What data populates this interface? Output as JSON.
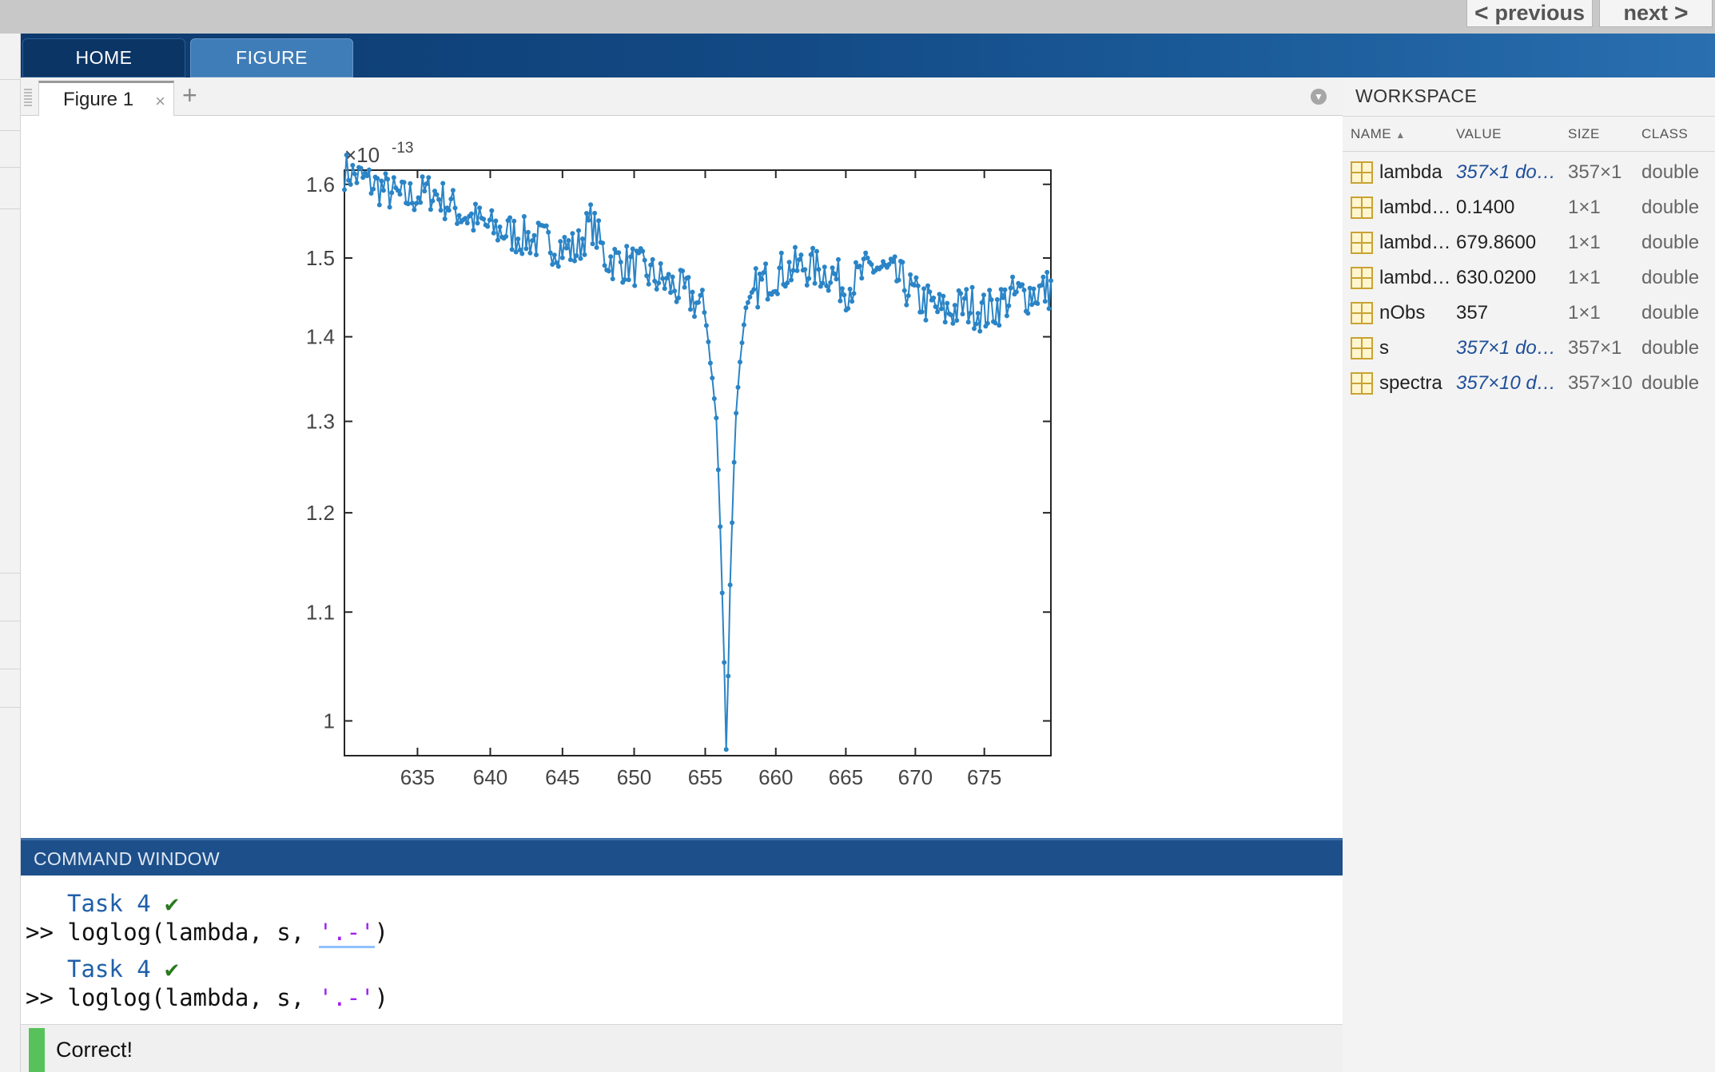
{
  "nav": {
    "previous_label": "previous",
    "next_label": "next"
  },
  "ribbon": {
    "tabs": [
      {
        "label": "HOME"
      },
      {
        "label": "FIGURE"
      }
    ]
  },
  "figure": {
    "tab_label": "Figure 1",
    "close_symbol": "×",
    "add_symbol": "+"
  },
  "chart_data": {
    "type": "line",
    "series": [
      {
        "marker": "point",
        "line": "solid",
        "color": "#2a84c6"
      }
    ],
    "x_ticks": [
      "635",
      "640",
      "645",
      "650",
      "655",
      "660",
      "665",
      "670",
      "675"
    ],
    "y_ticks": [
      "1",
      "1.1",
      "1.2",
      "1.3",
      "1.4",
      "1.5",
      "1.6"
    ],
    "y_exponent_label": "×10",
    "y_exponent_power": "-13",
    "xlim": [
      630.02,
      679.86
    ],
    "ylim": [
      9.7e-14,
      1.62e-13
    ],
    "x_scale": "log",
    "y_scale": "log",
    "grid": false,
    "description_points": {
      "x": [
        630.02,
        632,
        634,
        636,
        638,
        640,
        642,
        644,
        646,
        647,
        648,
        650,
        652,
        654,
        655,
        655.8,
        656.2,
        656.5,
        656.8,
        657.2,
        657.8,
        658.5,
        660,
        662,
        664,
        665,
        667,
        669,
        670,
        672,
        674,
        675,
        677,
        679.86
      ],
      "y": [
        1.62e-13,
        1.6e-13,
        1.58e-13,
        1.59e-13,
        1.56e-13,
        1.54e-13,
        1.53e-13,
        1.52e-13,
        1.51e-13,
        1.55e-13,
        1.5e-13,
        1.49e-13,
        1.47e-13,
        1.45e-13,
        1.43e-13,
        1.3e-13,
        1.12e-13,
        9.7e-14,
        1.15e-13,
        1.32e-13,
        1.43e-13,
        1.46e-13,
        1.48e-13,
        1.49e-13,
        1.48e-13,
        1.46e-13,
        1.49e-13,
        1.47e-13,
        1.45e-13,
        1.43e-13,
        1.44e-13,
        1.43e-13,
        1.45e-13,
        1.46e-13
      ]
    }
  },
  "workspace": {
    "title": "WORKSPACE",
    "columns": {
      "name": "NAME",
      "value": "VALUE",
      "size": "SIZE",
      "class": "CLASS"
    },
    "rows": [
      {
        "name": "lambda",
        "value": "357×1 do…",
        "size": "357×1",
        "class": "double",
        "italic": true
      },
      {
        "name": "lambd…",
        "value": "0.1400",
        "size": "1×1",
        "class": "double",
        "italic": false
      },
      {
        "name": "lambd…",
        "value": "679.8600",
        "size": "1×1",
        "class": "double",
        "italic": false
      },
      {
        "name": "lambd…",
        "value": "630.0200",
        "size": "1×1",
        "class": "double",
        "italic": false
      },
      {
        "name": "nObs",
        "value": "357",
        "size": "1×1",
        "class": "double",
        "italic": false
      },
      {
        "name": "s",
        "value": "357×1 do…",
        "size": "357×1",
        "class": "double",
        "italic": true
      },
      {
        "name": "spectra",
        "value": "357×10 d…",
        "size": "357×10",
        "class": "double",
        "italic": true
      }
    ]
  },
  "command_window": {
    "title": "COMMAND WINDOW",
    "lines": [
      {
        "task": "Task 4",
        "check": "✔",
        "prompt": ">>",
        "code_pre": "loglog(lambda, s, ",
        "code_str": "'.-'",
        "code_post": ")"
      },
      {
        "task": "Task 4",
        "check": "✔",
        "prompt": ">>",
        "code_pre": "loglog(lambda, s, ",
        "code_str": "'.-'",
        "code_post": ")"
      }
    ]
  },
  "result": {
    "message": "Correct!"
  }
}
